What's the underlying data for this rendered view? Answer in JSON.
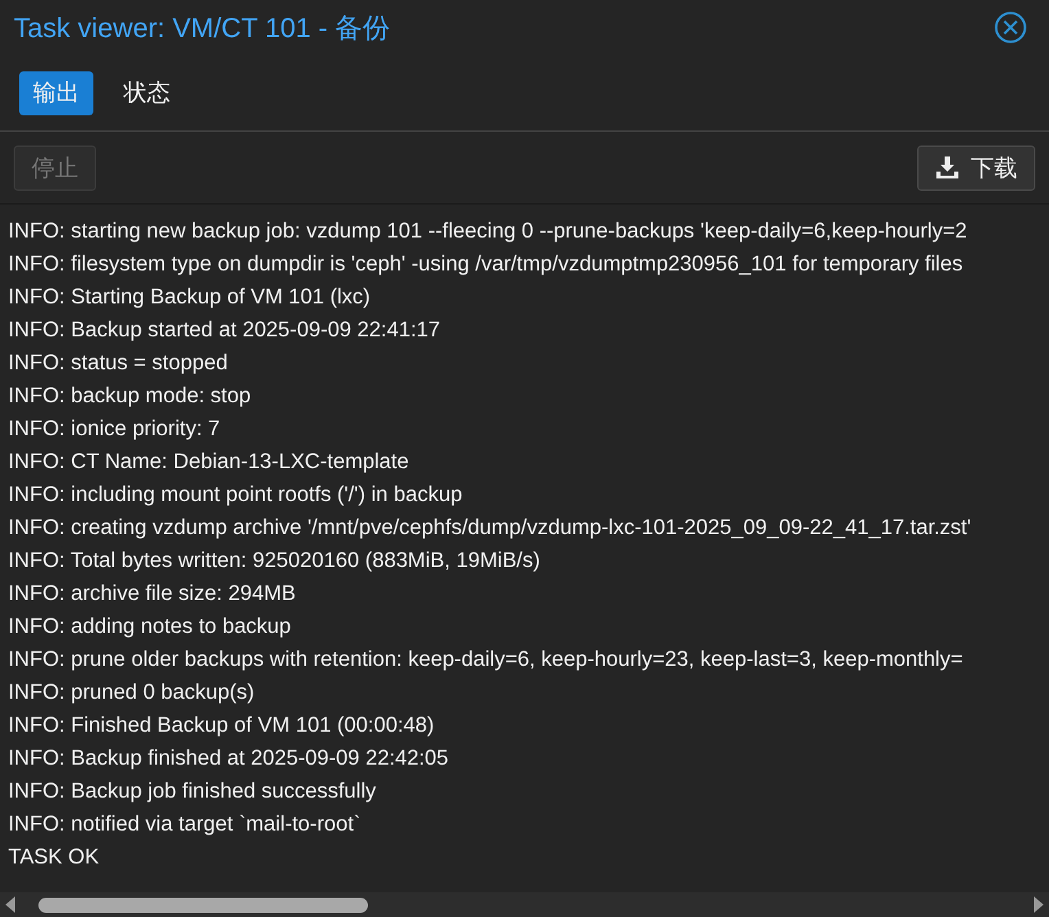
{
  "window": {
    "title": "Task viewer: VM/CT 101 - 备份"
  },
  "tabs": [
    {
      "label": "输出",
      "selected": true
    },
    {
      "label": "状态",
      "selected": false
    }
  ],
  "toolbar": {
    "stop": {
      "label": "停止",
      "disabled": true
    },
    "download": {
      "label": "下载",
      "disabled": false
    }
  },
  "log_lines": [
    "INFO: starting new backup job: vzdump 101 --fleecing 0 --prune-backups 'keep-daily=6,keep-hourly=2",
    "INFO: filesystem type on dumpdir is 'ceph' -using /var/tmp/vzdumptmp230956_101 for temporary files",
    "INFO: Starting Backup of VM 101 (lxc)",
    "INFO: Backup started at 2025-09-09 22:41:17",
    "INFO: status = stopped",
    "INFO: backup mode: stop",
    "INFO: ionice priority: 7",
    "INFO: CT Name: Debian-13-LXC-template",
    "INFO: including mount point rootfs ('/') in backup",
    "INFO: creating vzdump archive '/mnt/pve/cephfs/dump/vzdump-lxc-101-2025_09_09-22_41_17.tar.zst'",
    "INFO: Total bytes written: 925020160 (883MiB, 19MiB/s)",
    "INFO: archive file size: 294MB",
    "INFO: adding notes to backup",
    "INFO: prune older backups with retention: keep-daily=6, keep-hourly=23, keep-last=3, keep-monthly=",
    "INFO: pruned 0 backup(s)",
    "INFO: Finished Backup of VM 101 (00:00:48)",
    "INFO: Backup finished at 2025-09-09 22:42:05",
    "INFO: Backup job finished successfully",
    "INFO: notified via target `mail-to-root`",
    "TASK OK"
  ]
}
